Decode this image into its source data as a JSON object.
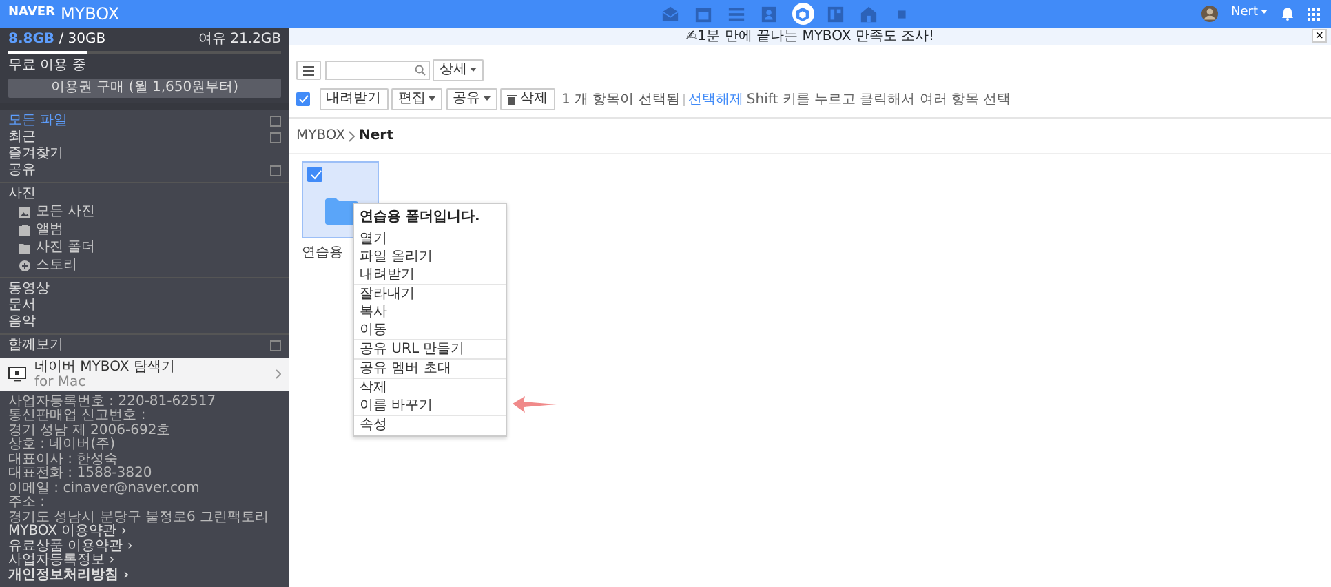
{
  "header": {
    "brand": "NAVER",
    "product": "MYBOX",
    "apps": [
      {
        "kind": "mail",
        "selected": false
      },
      {
        "kind": "calendar",
        "selected": false
      },
      {
        "kind": "list",
        "selected": false
      },
      {
        "kind": "contacts",
        "selected": false
      },
      {
        "kind": "box",
        "selected": true
      },
      {
        "kind": "layout",
        "selected": false
      },
      {
        "kind": "home",
        "selected": false
      },
      {
        "kind": "square",
        "selected": false
      }
    ],
    "user": "Nert"
  },
  "banner": {
    "text": "✍1분 만에 끝나는 MYBOX 만족도 조사!",
    "close": "×"
  },
  "sidebar": {
    "storage": {
      "used": "8.8GB",
      "total": "/ 30GB",
      "free": "여유 21.2GB",
      "level": 0.29,
      "plan": "무료 이용 중",
      "buy_button": "이용권 구매 (월 1,650원부터)"
    },
    "nav": [
      {
        "label": "모든 파일",
        "selected": true,
        "expandable": true
      },
      {
        "label": "최근",
        "selected": false,
        "expandable": true
      },
      {
        "label": "즐겨찾기",
        "selected": false,
        "expandable": false
      },
      {
        "label": "공유",
        "selected": false,
        "expandable": true
      }
    ],
    "photos": {
      "label": "사진",
      "items": [
        {
          "label": "모든 사진",
          "kind": "image"
        },
        {
          "label": "앨범",
          "kind": "album"
        },
        {
          "label": "사진 폴더",
          "kind": "folder"
        },
        {
          "label": "스토리",
          "kind": "story"
        }
      ]
    },
    "media": [
      {
        "label": "동영상"
      },
      {
        "label": "문서"
      },
      {
        "label": "음악"
      }
    ],
    "together": {
      "label": "함께보기",
      "expandable": true
    },
    "explorer": {
      "title": "네이버 MYBOX 탐색기",
      "subtitle": "for Mac"
    },
    "company": [
      "사업자등록번호 : 220-81-62517",
      "통신판매업 신고번호 :",
      "경기 성남 제 2006-692호",
      "상호 : 네이버(주)",
      "대표이사 : 한성숙",
      "대표전화 : 1588-3820",
      "이메일 : cinaver@naver.com",
      "주소 :",
      "경기도 성남시 분당구 불정로6 그린팩토리"
    ],
    "links": [
      "MYBOX 이용약관 ›",
      "유료상품 이용약관 ›",
      "사업자등록정보 ›",
      "개인정보처리방침 ›"
    ]
  },
  "toolbar": {
    "detail_button": "상세",
    "select_all": {
      "checked": true
    },
    "buttons": [
      {
        "label": "내려받기",
        "kind": "plain"
      },
      {
        "label": "편집",
        "kind": "dropdown"
      },
      {
        "label": "공유",
        "kind": "dropdown"
      },
      {
        "label": "삭제",
        "kind": "delete"
      }
    ],
    "selection_info": "1 개 항목이 선택됨",
    "deselect": "선택해제",
    "hint": "Shift 키를 누르고 클릭해서 여러 항목 선택"
  },
  "breadcrumb": [
    "MYBOX",
    "Nert"
  ],
  "files": [
    {
      "name": "연습용",
      "kind": "folder",
      "selected": true
    }
  ],
  "context_menu": {
    "title": "연습용 폴더입니다.",
    "groups": [
      [
        "열기",
        "파일 올리기",
        "내려받기"
      ],
      [
        "잘라내기",
        "복사",
        "이동"
      ],
      [
        "공유 URL 만들기"
      ],
      [
        "공유 멤버 초대"
      ],
      [
        "삭제",
        "이름 바꾸기"
      ],
      [
        "속성"
      ]
    ]
  }
}
